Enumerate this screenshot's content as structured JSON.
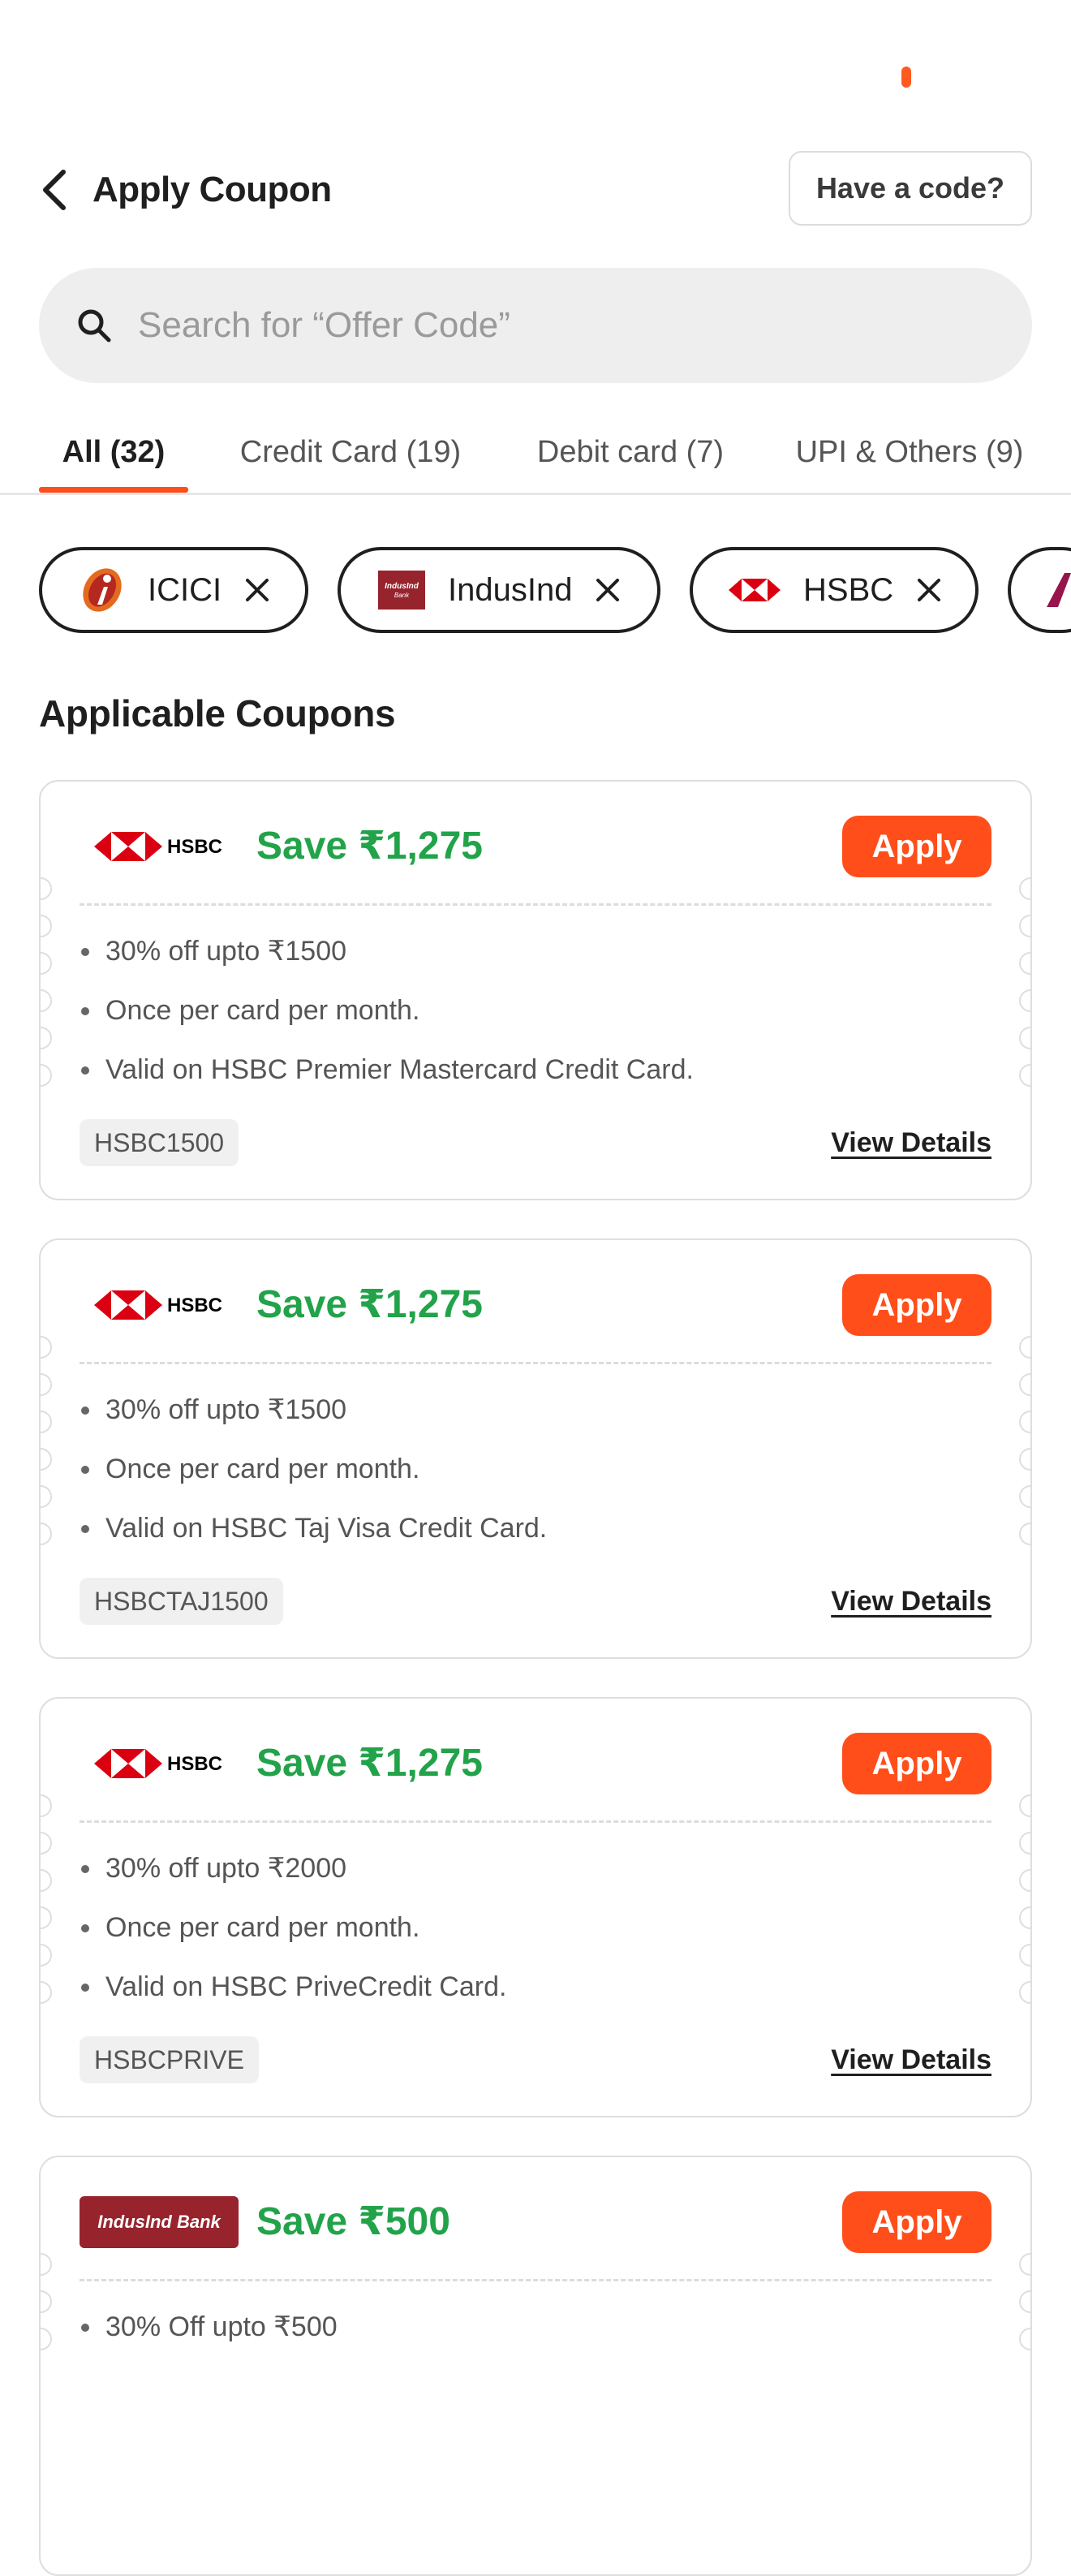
{
  "header": {
    "title": "Apply Coupon",
    "have_code_label": "Have a code?"
  },
  "search": {
    "placeholder": "Search for “Offer Code”"
  },
  "tabs": [
    {
      "label": "All (32)",
      "active": true
    },
    {
      "label": "Credit Card (19)",
      "active": false
    },
    {
      "label": "Debit card (7)",
      "active": false
    },
    {
      "label": "UPI & Others (9)",
      "active": false
    }
  ],
  "filters": [
    {
      "label": "ICICI"
    },
    {
      "label": "IndusInd"
    },
    {
      "label": "HSBC"
    }
  ],
  "section_title": "Applicable Coupons",
  "coupons": [
    {
      "bank": "HSBC",
      "save": "Save ₹1,275",
      "apply_label": "Apply",
      "bullets": [
        "30% off upto ₹1500",
        "Once per card per month.",
        "Valid on HSBC Premier Mastercard Credit Card."
      ],
      "code": "HSBC1500",
      "details_label": "View Details"
    },
    {
      "bank": "HSBC",
      "save": "Save ₹1,275",
      "apply_label": "Apply",
      "bullets": [
        "30% off upto ₹1500",
        "Once per card per month.",
        "Valid on HSBC Taj Visa Credit Card."
      ],
      "code": "HSBCTAJ1500",
      "details_label": "View Details"
    },
    {
      "bank": "HSBC",
      "save": "Save ₹1,275",
      "apply_label": "Apply",
      "bullets": [
        "30% off upto ₹2000",
        "Once per card per month.",
        "Valid on HSBC PriveCredit Card."
      ],
      "code": "HSBCPRIVE",
      "details_label": "View Details"
    },
    {
      "bank": "IndusInd Bank",
      "save": "Save ₹500",
      "apply_label": "Apply",
      "bullets": [
        "30% Off upto ₹500"
      ],
      "code": "",
      "details_label": ""
    }
  ],
  "colors": {
    "accent": "#ff4e1a",
    "save_green": "#22a34a",
    "hsbc_red": "#db0011",
    "indusind_maroon": "#97232d",
    "icici_orange": "#e46a1f"
  },
  "icons": {
    "back": "chevron-left-icon",
    "search": "search-icon",
    "close": "close-icon"
  }
}
